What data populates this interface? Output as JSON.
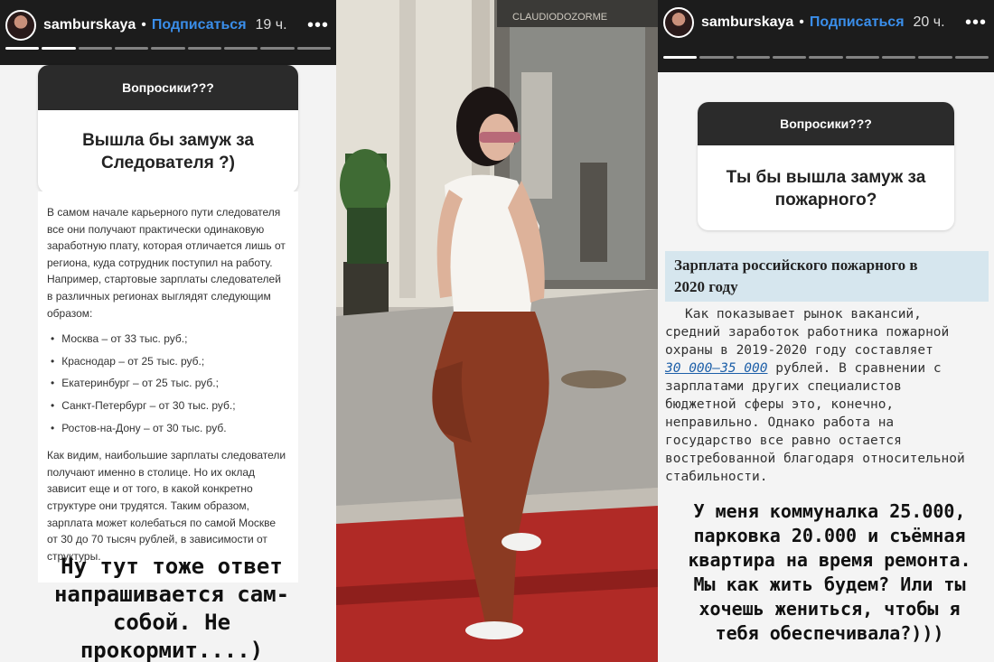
{
  "story_left": {
    "username": "samburskaya",
    "follow_label": "Подписаться",
    "time": "19 ч.",
    "more": "•••",
    "sticker": {
      "title": "Вопросики???",
      "question_line1": "Вышла бы замуж за",
      "question_line2": "Следователя ?)"
    },
    "article": {
      "intro": "В самом начале карьерного пути следователя все они получают практически одинаковую заработную плату, которая отличается лишь от региона, куда сотрудник поступил на работу. Например, стартовые зарплаты следователей в различных регионах выглядят следующим образом:",
      "items": [
        "Москва – от 33 тыс. руб.;",
        "Краснодар – от 25 тыс. руб.;",
        "Екатеринбург – от 25 тыс. руб.;",
        "Санкт-Петербург – от 30 тыс. руб.;",
        "Ростов-на-Дону – от 30 тыс. руб."
      ],
      "outro": "Как видим, наибольшие зарплаты следователи получают именно в столице. Но их оклад зависит еще и от того, в какой конкретно структуре они трудятся. Таким образом, зарплата может колебаться по самой Москве от 30 до 70 тысяч рублей, в зависимости от структуры."
    },
    "caption": {
      "line1": "Ну тут тоже ответ",
      "line2": "напрашивается сам-",
      "line3": "собой. Не",
      "line4": "прокормит....)"
    }
  },
  "story_middle": {
    "store_sign": "CLAUDIODOZORME"
  },
  "story_right": {
    "username": "samburskaya",
    "follow_label": "Подписаться",
    "time": "20 ч.",
    "more": "•••",
    "sticker": {
      "title": "Вопросики???",
      "question_line1": "Ты бы вышла замуж за",
      "question_line2": "пожарного?"
    },
    "article": {
      "heading_line1": "Зарплата российского пожарного в",
      "heading_line2": "2020 году",
      "body_lines": [
        "Как показывает рынок вакансий,",
        "средний заработок работника пожарной",
        "охраны в 2019-2020 году составляет"
      ],
      "link": "30 000–35 000",
      "after_link": " рублей. В сравнении с",
      "rest_lines": [
        "зарплатами других специалистов",
        "бюджетной сферы это, конечно,",
        "неправильно. Однако работа на",
        "государство все равно остается",
        "востребованной благодаря относительной",
        "стабильности."
      ]
    },
    "caption": {
      "line1": "У меня коммуналка 25.000,",
      "line2": "парковка 20.000 и съёмная",
      "line3": "квартира на время ремонта.",
      "line4": "Мы как жить будем? Или ты",
      "line5": "хочешь жениться, чтобы я",
      "line6": "тебя обеспечивала?)))"
    }
  },
  "colors": {
    "follow": "#3a8eea",
    "sticker_header": "#2b2b2b",
    "article_heading_bg": "#d6e6ee",
    "link": "#1d5fa8"
  }
}
